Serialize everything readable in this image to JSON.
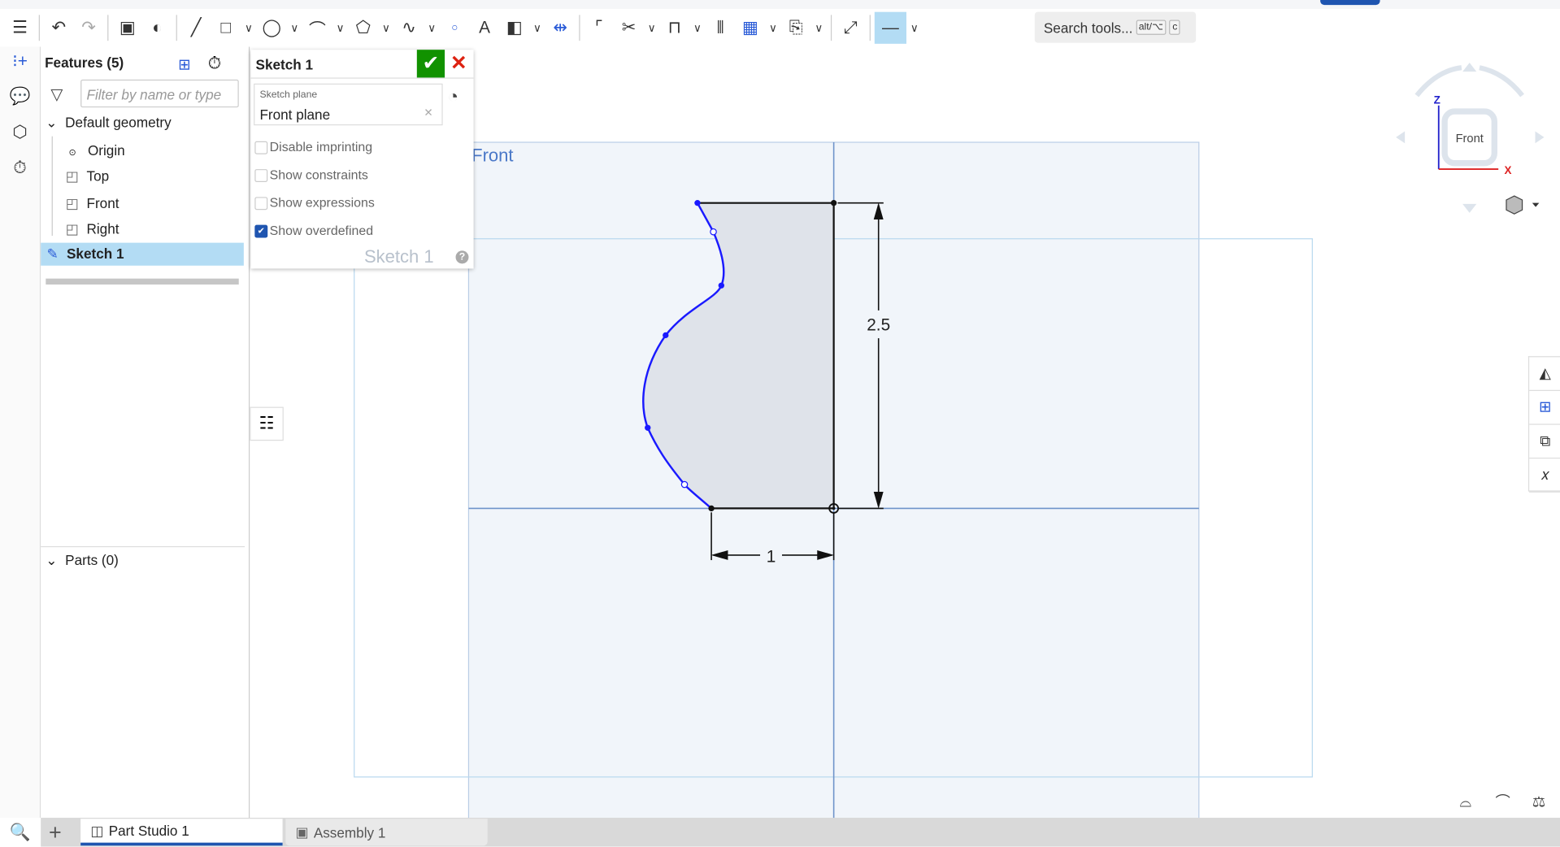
{
  "toolbar": {
    "search_label": "Search tools...",
    "search_shortcut_1": "alt/⌥",
    "search_shortcut_2": "c",
    "tools": [
      "feature-list",
      "undo",
      "redo",
      "new-sketch-plane",
      "revolve",
      "line",
      "rectangle",
      "circle",
      "arc",
      "polygon",
      "spline",
      "point",
      "text",
      "construction",
      "dimension",
      "fillet",
      "trim",
      "offset",
      "mirror",
      "pattern",
      "dxf-import",
      "transform",
      "line-style"
    ]
  },
  "features": {
    "title": "Features (5)",
    "filter_placeholder": "Filter by name or type",
    "default_geometry": "Default geometry",
    "items": [
      {
        "label": "Origin",
        "icon": "origin-icon"
      },
      {
        "label": "Top",
        "icon": "plane-icon"
      },
      {
        "label": "Front",
        "icon": "plane-icon"
      },
      {
        "label": "Right",
        "icon": "plane-icon"
      }
    ],
    "selected": "Sketch 1",
    "parts": "Parts (0)"
  },
  "dialog": {
    "title": "Sketch 1",
    "plane_label": "Sketch plane",
    "plane_value": "Front plane",
    "options": [
      {
        "label": "Disable imprinting",
        "checked": false
      },
      {
        "label": "Show constraints",
        "checked": false
      },
      {
        "label": "Show expressions",
        "checked": false
      },
      {
        "label": "Show overdefined",
        "checked": true
      }
    ]
  },
  "viewport": {
    "plane_label": "Front",
    "dim_height": "2.5",
    "dim_width": "1",
    "ghost_label": "Sketch 1"
  },
  "viewcube": {
    "face": "Front",
    "axis_z": "Z",
    "axis_x": "X"
  },
  "tabs": [
    {
      "label": "Part Studio 1",
      "active": true
    },
    {
      "label": "Assembly 1",
      "active": false
    }
  ],
  "colors": {
    "accent": "#1f55b0",
    "ok": "#119200",
    "cancel": "#dd2211",
    "sketch_curve": "#1a1aff",
    "selection": "#b3dcf4"
  }
}
